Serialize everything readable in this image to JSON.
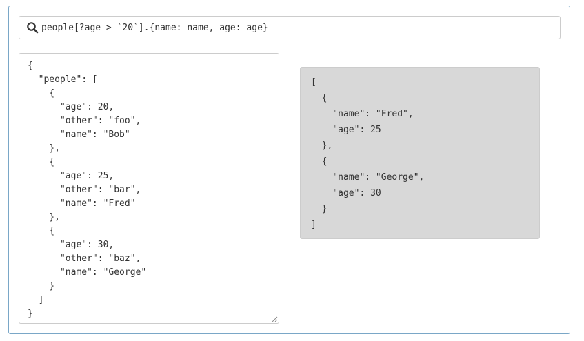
{
  "search": {
    "value": "people[?age > `20`].{name: name, age: age}",
    "icon": "search-icon"
  },
  "input": {
    "json_text": "{\n  \"people\": [\n    {\n      \"age\": 20,\n      \"other\": \"foo\",\n      \"name\": \"Bob\"\n    },\n    {\n      \"age\": 25,\n      \"other\": \"bar\",\n      \"name\": \"Fred\"\n    },\n    {\n      \"age\": 30,\n      \"other\": \"baz\",\n      \"name\": \"George\"\n    }\n  ]\n}"
  },
  "output": {
    "json_text": "[\n  {\n    \"name\": \"Fred\",\n    \"age\": 25\n  },\n  {\n    \"name\": \"George\",\n    \"age\": 30\n  }\n]"
  },
  "colors": {
    "frame_border": "#7aa7c7",
    "output_background": "#d8d8d8",
    "text": "#333333"
  }
}
